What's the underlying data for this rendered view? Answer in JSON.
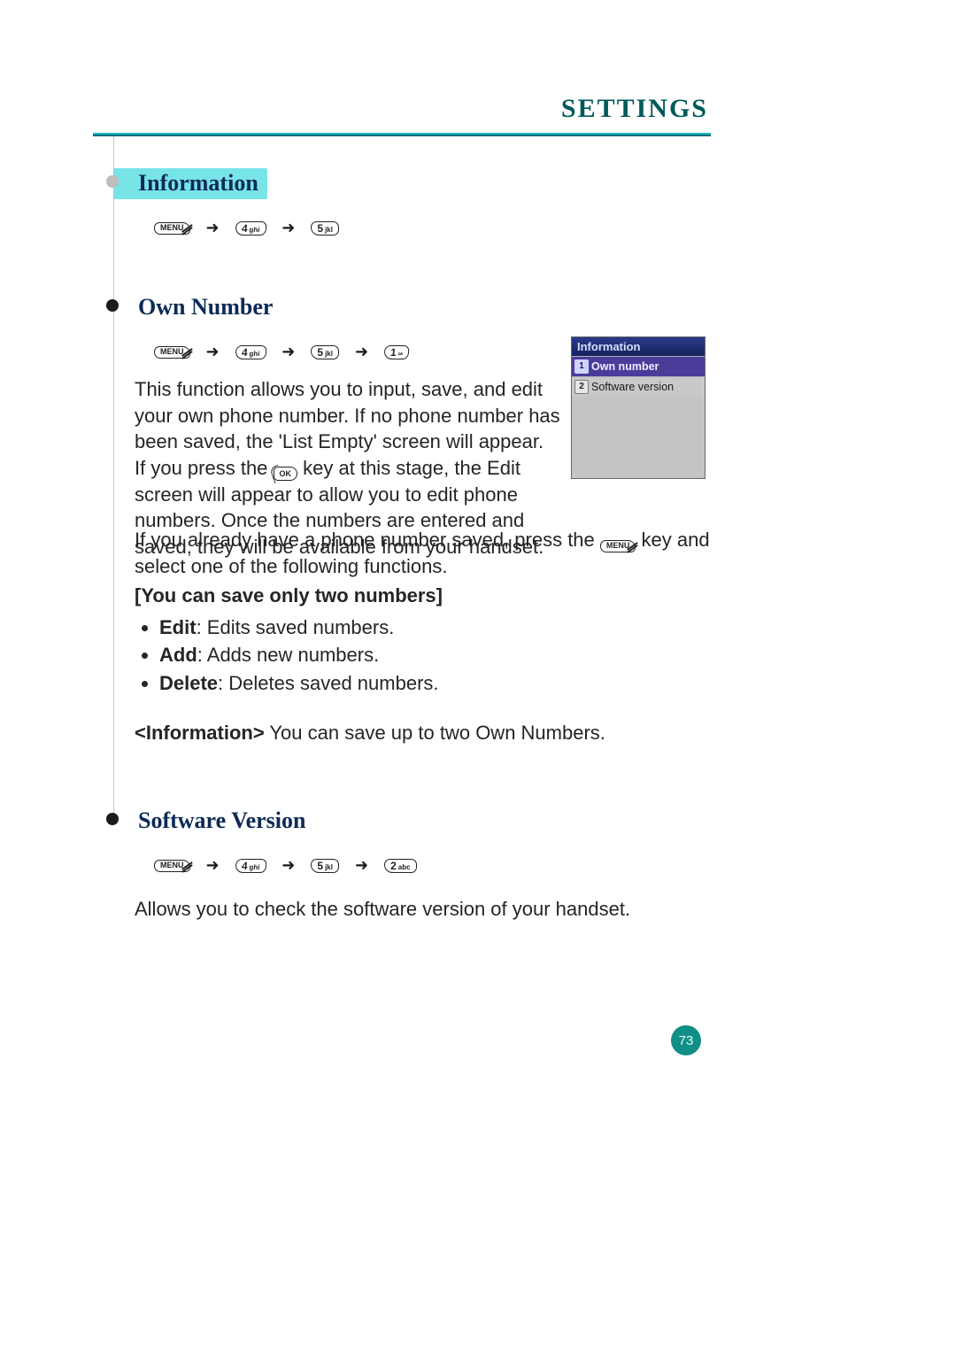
{
  "page_title": "SETTINGS",
  "page_number": "73",
  "sections": {
    "information": {
      "title": "Information",
      "keyseq": [
        "MENU",
        "4 ghi",
        "5 jkl"
      ]
    },
    "own_number": {
      "title": "Own Number",
      "keyseq": [
        "MENU",
        "4 ghi",
        "5 jkl",
        "1 ∞"
      ],
      "para1a": "This function allows you to input, save, and edit your own phone number. If no phone number has been saved, the 'List Empty' screen will appear.",
      "para1b_pre": "If you press the ",
      "para1b_post": " key at this stage, the Edit screen will appear to allow you to edit phone numbers. Once the numbers are entered and saved, they will be available from your handset.",
      "para2_pre": "If you already have a phone number saved, press the ",
      "para2_post": " key and select one of the following functions.",
      "limit_note": "[You can save only two numbers]",
      "functions": [
        {
          "name": "Edit",
          "desc": ": Edits saved numbers."
        },
        {
          "name": "Add",
          "desc": ": Adds new numbers."
        },
        {
          "name": "Delete",
          "desc": ": Deletes saved numbers."
        }
      ],
      "info_label": "<Information>",
      "info_text": " You can save up to two Own Numbers."
    },
    "software_version": {
      "title": "Software Version",
      "keyseq": [
        "MENU",
        "4 ghi",
        "5 jkl",
        "2 abc"
      ],
      "para": "Allows you to check the software version of your handset."
    }
  },
  "phone_mock": {
    "title": "Information",
    "items": [
      {
        "n": "1",
        "label": "Own number",
        "selected": true
      },
      {
        "n": "2",
        "label": "Software version",
        "selected": false
      }
    ]
  },
  "key_labels": {
    "menu": "MENU",
    "ok": "OK",
    "k4": "4",
    "k4s": "ghi",
    "k5": "5",
    "k5s": "jkl",
    "k1": "1",
    "k1s": "∞",
    "k2": "2",
    "k2s": "abc"
  }
}
